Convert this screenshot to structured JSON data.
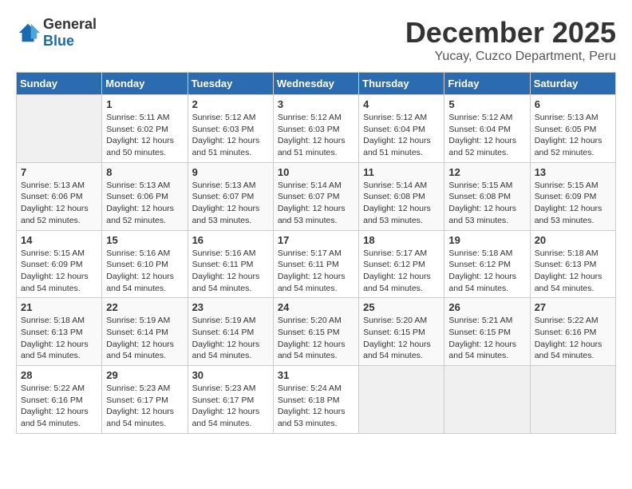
{
  "logo": {
    "general": "General",
    "blue": "Blue"
  },
  "header": {
    "month_year": "December 2025",
    "location": "Yucay, Cuzco Department, Peru"
  },
  "columns": [
    "Sunday",
    "Monday",
    "Tuesday",
    "Wednesday",
    "Thursday",
    "Friday",
    "Saturday"
  ],
  "weeks": [
    [
      {
        "day": "",
        "sunrise": "",
        "sunset": "",
        "daylight": ""
      },
      {
        "day": "1",
        "sunrise": "Sunrise: 5:11 AM",
        "sunset": "Sunset: 6:02 PM",
        "daylight": "Daylight: 12 hours and 50 minutes."
      },
      {
        "day": "2",
        "sunrise": "Sunrise: 5:12 AM",
        "sunset": "Sunset: 6:03 PM",
        "daylight": "Daylight: 12 hours and 51 minutes."
      },
      {
        "day": "3",
        "sunrise": "Sunrise: 5:12 AM",
        "sunset": "Sunset: 6:03 PM",
        "daylight": "Daylight: 12 hours and 51 minutes."
      },
      {
        "day": "4",
        "sunrise": "Sunrise: 5:12 AM",
        "sunset": "Sunset: 6:04 PM",
        "daylight": "Daylight: 12 hours and 51 minutes."
      },
      {
        "day": "5",
        "sunrise": "Sunrise: 5:12 AM",
        "sunset": "Sunset: 6:04 PM",
        "daylight": "Daylight: 12 hours and 52 minutes."
      },
      {
        "day": "6",
        "sunrise": "Sunrise: 5:13 AM",
        "sunset": "Sunset: 6:05 PM",
        "daylight": "Daylight: 12 hours and 52 minutes."
      }
    ],
    [
      {
        "day": "7",
        "sunrise": "Sunrise: 5:13 AM",
        "sunset": "Sunset: 6:06 PM",
        "daylight": "Daylight: 12 hours and 52 minutes."
      },
      {
        "day": "8",
        "sunrise": "Sunrise: 5:13 AM",
        "sunset": "Sunset: 6:06 PM",
        "daylight": "Daylight: 12 hours and 52 minutes."
      },
      {
        "day": "9",
        "sunrise": "Sunrise: 5:13 AM",
        "sunset": "Sunset: 6:07 PM",
        "daylight": "Daylight: 12 hours and 53 minutes."
      },
      {
        "day": "10",
        "sunrise": "Sunrise: 5:14 AM",
        "sunset": "Sunset: 6:07 PM",
        "daylight": "Daylight: 12 hours and 53 minutes."
      },
      {
        "day": "11",
        "sunrise": "Sunrise: 5:14 AM",
        "sunset": "Sunset: 6:08 PM",
        "daylight": "Daylight: 12 hours and 53 minutes."
      },
      {
        "day": "12",
        "sunrise": "Sunrise: 5:15 AM",
        "sunset": "Sunset: 6:08 PM",
        "daylight": "Daylight: 12 hours and 53 minutes."
      },
      {
        "day": "13",
        "sunrise": "Sunrise: 5:15 AM",
        "sunset": "Sunset: 6:09 PM",
        "daylight": "Daylight: 12 hours and 53 minutes."
      }
    ],
    [
      {
        "day": "14",
        "sunrise": "Sunrise: 5:15 AM",
        "sunset": "Sunset: 6:09 PM",
        "daylight": "Daylight: 12 hours and 54 minutes."
      },
      {
        "day": "15",
        "sunrise": "Sunrise: 5:16 AM",
        "sunset": "Sunset: 6:10 PM",
        "daylight": "Daylight: 12 hours and 54 minutes."
      },
      {
        "day": "16",
        "sunrise": "Sunrise: 5:16 AM",
        "sunset": "Sunset: 6:11 PM",
        "daylight": "Daylight: 12 hours and 54 minutes."
      },
      {
        "day": "17",
        "sunrise": "Sunrise: 5:17 AM",
        "sunset": "Sunset: 6:11 PM",
        "daylight": "Daylight: 12 hours and 54 minutes."
      },
      {
        "day": "18",
        "sunrise": "Sunrise: 5:17 AM",
        "sunset": "Sunset: 6:12 PM",
        "daylight": "Daylight: 12 hours and 54 minutes."
      },
      {
        "day": "19",
        "sunrise": "Sunrise: 5:18 AM",
        "sunset": "Sunset: 6:12 PM",
        "daylight": "Daylight: 12 hours and 54 minutes."
      },
      {
        "day": "20",
        "sunrise": "Sunrise: 5:18 AM",
        "sunset": "Sunset: 6:13 PM",
        "daylight": "Daylight: 12 hours and 54 minutes."
      }
    ],
    [
      {
        "day": "21",
        "sunrise": "Sunrise: 5:18 AM",
        "sunset": "Sunset: 6:13 PM",
        "daylight": "Daylight: 12 hours and 54 minutes."
      },
      {
        "day": "22",
        "sunrise": "Sunrise: 5:19 AM",
        "sunset": "Sunset: 6:14 PM",
        "daylight": "Daylight: 12 hours and 54 minutes."
      },
      {
        "day": "23",
        "sunrise": "Sunrise: 5:19 AM",
        "sunset": "Sunset: 6:14 PM",
        "daylight": "Daylight: 12 hours and 54 minutes."
      },
      {
        "day": "24",
        "sunrise": "Sunrise: 5:20 AM",
        "sunset": "Sunset: 6:15 PM",
        "daylight": "Daylight: 12 hours and 54 minutes."
      },
      {
        "day": "25",
        "sunrise": "Sunrise: 5:20 AM",
        "sunset": "Sunset: 6:15 PM",
        "daylight": "Daylight: 12 hours and 54 minutes."
      },
      {
        "day": "26",
        "sunrise": "Sunrise: 5:21 AM",
        "sunset": "Sunset: 6:15 PM",
        "daylight": "Daylight: 12 hours and 54 minutes."
      },
      {
        "day": "27",
        "sunrise": "Sunrise: 5:22 AM",
        "sunset": "Sunset: 6:16 PM",
        "daylight": "Daylight: 12 hours and 54 minutes."
      }
    ],
    [
      {
        "day": "28",
        "sunrise": "Sunrise: 5:22 AM",
        "sunset": "Sunset: 6:16 PM",
        "daylight": "Daylight: 12 hours and 54 minutes."
      },
      {
        "day": "29",
        "sunrise": "Sunrise: 5:23 AM",
        "sunset": "Sunset: 6:17 PM",
        "daylight": "Daylight: 12 hours and 54 minutes."
      },
      {
        "day": "30",
        "sunrise": "Sunrise: 5:23 AM",
        "sunset": "Sunset: 6:17 PM",
        "daylight": "Daylight: 12 hours and 54 minutes."
      },
      {
        "day": "31",
        "sunrise": "Sunrise: 5:24 AM",
        "sunset": "Sunset: 6:18 PM",
        "daylight": "Daylight: 12 hours and 53 minutes."
      },
      {
        "day": "",
        "sunrise": "",
        "sunset": "",
        "daylight": ""
      },
      {
        "day": "",
        "sunrise": "",
        "sunset": "",
        "daylight": ""
      },
      {
        "day": "",
        "sunrise": "",
        "sunset": "",
        "daylight": ""
      }
    ]
  ]
}
